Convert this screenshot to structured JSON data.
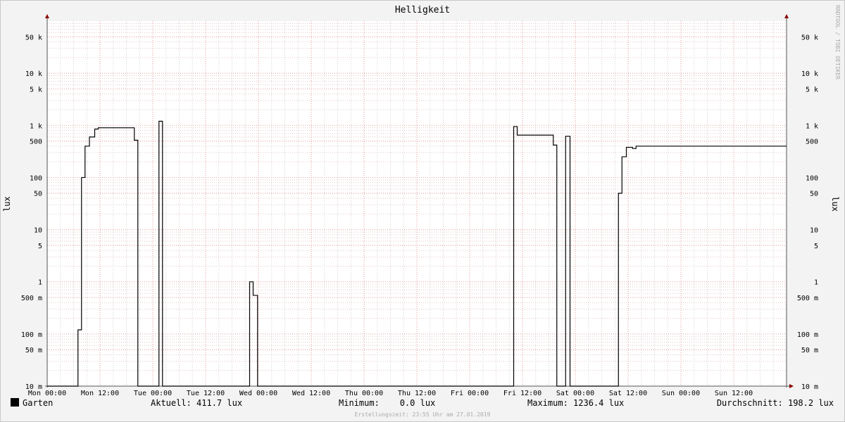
{
  "chart_data": {
    "type": "line",
    "title": "Helligkeit",
    "ylabel": "lux",
    "watermark": "RRDTOOL / TOBI OETIKER",
    "yscale": "log",
    "ylim": [
      0.01,
      100000
    ],
    "y_ticks": [
      {
        "value": 50000,
        "label": "50 k"
      },
      {
        "value": 10000,
        "label": "10 k"
      },
      {
        "value": 5000,
        "label": "5 k"
      },
      {
        "value": 1000,
        "label": "1 k"
      },
      {
        "value": 500,
        "label": "500"
      },
      {
        "value": 100,
        "label": "100"
      },
      {
        "value": 50,
        "label": "50"
      },
      {
        "value": 10,
        "label": "10"
      },
      {
        "value": 5,
        "label": "5"
      },
      {
        "value": 1,
        "label": "1"
      },
      {
        "value": 0.5,
        "label": "500 m"
      },
      {
        "value": 0.1,
        "label": "100 m"
      },
      {
        "value": 0.05,
        "label": "50 m"
      },
      {
        "value": 0.01,
        "label": "10 m"
      }
    ],
    "x_ticks": [
      "Mon 00:00",
      "Mon 12:00",
      "Tue 00:00",
      "Tue 12:00",
      "Wed 00:00",
      "Wed 12:00",
      "Thu 00:00",
      "Thu 12:00",
      "Fri 00:00",
      "Fri 12:00",
      "Sat 00:00",
      "Sat 12:00",
      "Sun 00:00",
      "Sun 12:00"
    ],
    "x_range_hours": [
      0,
      168
    ],
    "series": [
      {
        "name": "Garten",
        "color": "#000000",
        "points": [
          [
            0,
            0.01
          ],
          [
            7.0,
            0.01
          ],
          [
            7.0,
            0.12
          ],
          [
            7.8,
            0.12
          ],
          [
            7.8,
            100
          ],
          [
            8.6,
            100
          ],
          [
            8.6,
            400
          ],
          [
            9.6,
            400
          ],
          [
            9.6,
            600
          ],
          [
            10.8,
            600
          ],
          [
            10.8,
            850
          ],
          [
            11.6,
            850
          ],
          [
            11.6,
            900
          ],
          [
            19.8,
            900
          ],
          [
            19.8,
            520
          ],
          [
            20.6,
            520
          ],
          [
            20.6,
            0.01
          ],
          [
            25.4,
            0.01
          ],
          [
            25.4,
            1200
          ],
          [
            26.2,
            1200
          ],
          [
            26.2,
            0.01
          ],
          [
            46.0,
            0.01
          ],
          [
            46.0,
            1.0
          ],
          [
            46.8,
            1.0
          ],
          [
            46.8,
            0.55
          ],
          [
            47.8,
            0.55
          ],
          [
            47.8,
            0.01
          ],
          [
            106.0,
            0.01
          ],
          [
            106.0,
            950
          ],
          [
            106.8,
            950
          ],
          [
            106.8,
            650
          ],
          [
            115.0,
            650
          ],
          [
            115.0,
            420
          ],
          [
            115.8,
            420
          ],
          [
            115.8,
            0.01
          ],
          [
            117.8,
            0.01
          ],
          [
            117.8,
            620
          ],
          [
            118.8,
            620
          ],
          [
            118.8,
            0.01
          ],
          [
            129.8,
            0.01
          ],
          [
            129.8,
            50
          ],
          [
            130.6,
            50
          ],
          [
            130.6,
            250
          ],
          [
            131.6,
            250
          ],
          [
            131.6,
            380
          ],
          [
            133.0,
            380
          ],
          [
            133.0,
            360
          ],
          [
            133.8,
            360
          ],
          [
            133.8,
            400
          ],
          [
            168,
            400
          ]
        ]
      }
    ]
  },
  "legend": {
    "series_name": "Garten",
    "aktuell": "Aktuell: 411.7 lux",
    "minimum": "Minimum:    0.0 lux",
    "maximum": "Maximum: 1236.4 lux",
    "durchschnitt": "Durchschnitt: 198.2 lux"
  },
  "footer": "Erstellungszeit: 23:55 Uhr am 27.01.2019"
}
